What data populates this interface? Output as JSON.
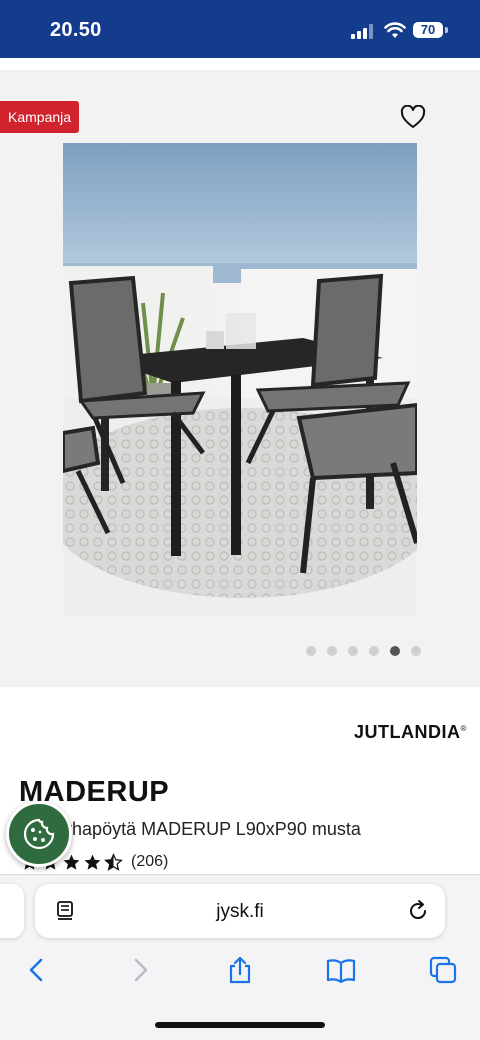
{
  "status_bar": {
    "time": "20.50",
    "battery": "70"
  },
  "product": {
    "badge": "Kampanja",
    "brand": "JUTLANDIA",
    "brand_mark": "®",
    "name": "MADERUP",
    "description": "Puutarhapöytä MADERUP L90xP90 musta",
    "rating_value": 4.5,
    "review_count": "(206)",
    "gallery": {
      "total_images": 6,
      "active_index": 4
    }
  },
  "browser": {
    "url": "jysk.fi"
  },
  "colors": {
    "header_blue": "#143c8c",
    "badge_red": "#d0232e",
    "cookie_green": "#2f6b3e"
  }
}
